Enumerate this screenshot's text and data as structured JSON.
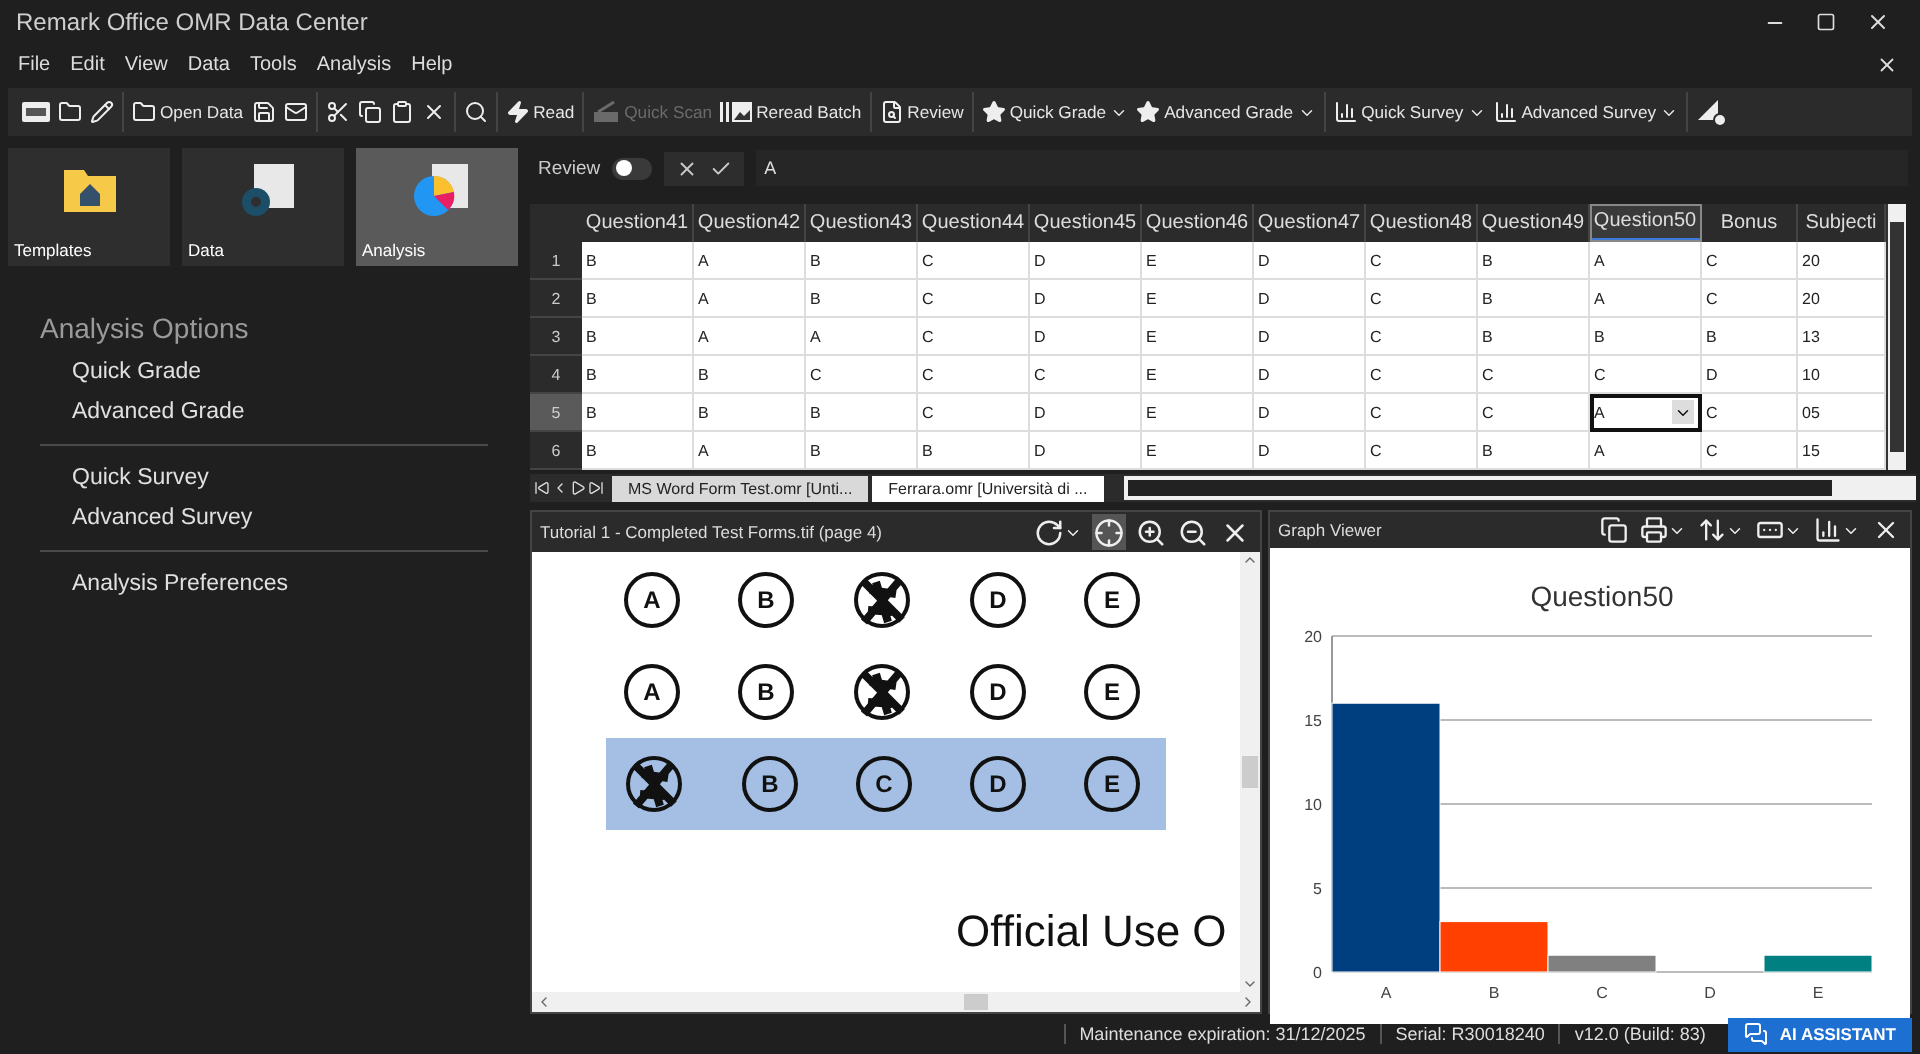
{
  "window": {
    "title": "Remark Office OMR Data Center"
  },
  "menu": [
    "File",
    "Edit",
    "View",
    "Data",
    "Tools",
    "Analysis",
    "Help"
  ],
  "toolbar": [
    [
      {
        "disabled": false,
        "dropdown": false
      },
      {
        "disabled": false,
        "dropdown": false
      },
      {
        "disabled": false,
        "dropdown": false
      }
    ],
    [
      {
        "label": "Open Data",
        "disabled": false,
        "dropdown": false
      },
      {
        "disabled": false,
        "dropdown": false
      },
      {
        "disabled": false,
        "dropdown": false
      }
    ],
    [
      {
        "disabled": false,
        "dropdown": false
      },
      {
        "disabled": false,
        "dropdown": false
      },
      {
        "disabled": false,
        "dropdown": false
      },
      {
        "disabled": false,
        "dropdown": false
      }
    ],
    [
      {
        "disabled": false,
        "dropdown": false
      }
    ],
    [
      {
        "label": "Read",
        "disabled": false,
        "dropdown": false
      }
    ],
    [
      {
        "label": "Quick Scan",
        "disabled": true,
        "dropdown": false
      },
      {
        "label": "Reread Batch",
        "disabled": false,
        "dropdown": false
      }
    ],
    [
      {
        "label": "Review",
        "disabled": false,
        "dropdown": false
      }
    ],
    [
      {
        "label": "Quick Grade",
        "disabled": false,
        "dropdown": true
      },
      {
        "label": "Advanced Grade",
        "disabled": false,
        "dropdown": true
      }
    ],
    [
      {
        "label": "Quick Survey",
        "disabled": false,
        "dropdown": true
      },
      {
        "label": "Advanced Survey",
        "disabled": false,
        "dropdown": true
      }
    ],
    [
      {
        "disabled": false,
        "dropdown": false
      }
    ]
  ],
  "tiles": [
    {
      "label": "Templates",
      "selected": false
    },
    {
      "label": "Data",
      "selected": false
    },
    {
      "label": "Analysis",
      "selected": true
    }
  ],
  "options": {
    "title": "Analysis Options",
    "groups": [
      [
        "Quick Grade",
        "Advanced Grade"
      ],
      [
        "Quick Survey",
        "Advanced Survey"
      ],
      [
        "Analysis Preferences"
      ]
    ]
  },
  "review_bar": {
    "label": "Review",
    "on": false,
    "value": "A"
  },
  "grid": {
    "columns": [
      {
        "label": "Question41",
        "selected": false
      },
      {
        "label": "Question42",
        "selected": false
      },
      {
        "label": "Question43",
        "selected": false
      },
      {
        "label": "Question44",
        "selected": false
      },
      {
        "label": "Question45",
        "selected": false
      },
      {
        "label": "Question46",
        "selected": false
      },
      {
        "label": "Question47",
        "selected": false
      },
      {
        "label": "Question48",
        "selected": false
      },
      {
        "label": "Question49",
        "selected": false
      },
      {
        "label": "Question50",
        "selected": true
      },
      {
        "label": "Bonus",
        "selected": false
      },
      {
        "label": "Subjecti",
        "selected": false
      }
    ],
    "rows": [
      {
        "number": "1",
        "selected": false,
        "cells": [
          "B",
          "A",
          "B",
          "C",
          "D",
          "E",
          "D",
          "C",
          "B",
          "A",
          "C",
          "20"
        ]
      },
      {
        "number": "2",
        "selected": false,
        "cells": [
          "B",
          "A",
          "B",
          "C",
          "D",
          "E",
          "D",
          "C",
          "B",
          "A",
          "C",
          "20"
        ]
      },
      {
        "number": "3",
        "selected": false,
        "cells": [
          "B",
          "A",
          "A",
          "C",
          "D",
          "E",
          "D",
          "C",
          "B",
          "B",
          "B",
          "13"
        ]
      },
      {
        "number": "4",
        "selected": false,
        "cells": [
          "B",
          "B",
          "C",
          "C",
          "C",
          "E",
          "D",
          "C",
          "C",
          "C",
          "D",
          "10"
        ]
      },
      {
        "number": "5",
        "selected": true,
        "cells": [
          "B",
          "B",
          "B",
          "C",
          "D",
          "E",
          "D",
          "C",
          "C",
          "A",
          "C",
          "05"
        ]
      },
      {
        "number": "6",
        "selected": false,
        "cells": [
          "B",
          "A",
          "B",
          "B",
          "D",
          "E",
          "D",
          "C",
          "B",
          "A",
          "C",
          "15"
        ]
      }
    ]
  },
  "sheet_tabs": [
    {
      "label": "MS Word Form Test.omr [Unti...",
      "selected": false
    },
    {
      "label": "Ferrara.omr [Università di ...",
      "selected": true
    }
  ],
  "image_viewer": {
    "title": "Tutorial 1 - Completed Test Forms.tif (page 4)",
    "rows": [
      {
        "highlighted": false,
        "bubbles": [
          {
            "letter": "A",
            "filled": false
          },
          {
            "letter": "B",
            "filled": false
          },
          {
            "filled": true
          },
          {
            "letter": "D",
            "filled": false
          },
          {
            "letter": "E",
            "filled": false
          }
        ]
      },
      {
        "highlighted": false,
        "bubbles": [
          {
            "letter": "A",
            "filled": false
          },
          {
            "letter": "B",
            "filled": false
          },
          {
            "filled": true
          },
          {
            "letter": "D",
            "filled": false
          },
          {
            "letter": "E",
            "filled": false
          }
        ]
      },
      {
        "highlighted": true,
        "bubbles": [
          {
            "filled": true
          },
          {
            "letter": "B",
            "filled": false
          },
          {
            "letter": "C",
            "filled": false
          },
          {
            "letter": "D",
            "filled": false
          },
          {
            "letter": "E",
            "filled": false
          }
        ]
      }
    ],
    "footer_text": "Official Use O"
  },
  "graph_viewer": {
    "title": "Graph Viewer",
    "chart_data": {
      "type": "bar",
      "title": "Question50",
      "categories": [
        "A",
        "B",
        "C",
        "D",
        "E"
      ],
      "values": [
        16,
        3,
        1,
        0,
        1
      ],
      "colors": [
        "#003f7f",
        "#ff4000",
        "#808080",
        null,
        "#008080"
      ],
      "grid": true,
      "ylim": [
        0,
        20
      ],
      "yticks": [
        0,
        5,
        10,
        15,
        20
      ]
    }
  },
  "status_bar": {
    "items": [
      "Maintenance expiration: 31/12/2025",
      "Serial: R30018240",
      "v12.0 (Build: 83)"
    ],
    "assistant": "AI ASSISTANT"
  }
}
